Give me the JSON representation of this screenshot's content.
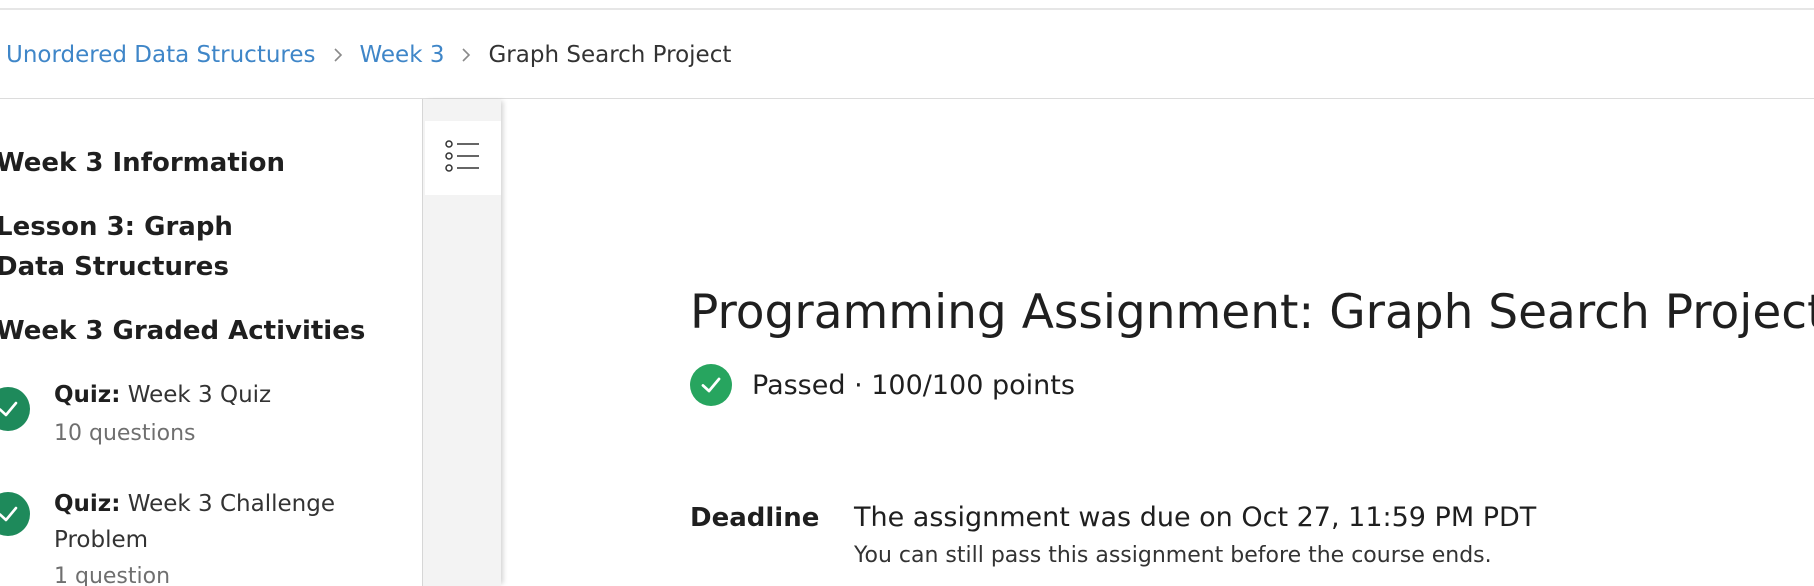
{
  "breadcrumb": {
    "items": [
      {
        "label": "Unordered Data Structures"
      },
      {
        "label": "Week 3"
      }
    ],
    "current": "Graph Search Project"
  },
  "sidebar": {
    "sections": [
      {
        "label": "Week 3 Information"
      },
      {
        "label": "Lesson 3: Graph Data Structures"
      },
      {
        "label": "Week 3 Graded Activities"
      }
    ],
    "items": [
      {
        "type": "Quiz:",
        "title": "Week 3 Quiz",
        "meta": "10 questions",
        "icon": "check-circle-icon"
      },
      {
        "type": "Quiz:",
        "title": "Week 3 Challenge Problem",
        "meta": "1 question",
        "icon": "check-circle-icon"
      }
    ]
  },
  "toggle": {
    "icon": "list-icon"
  },
  "main": {
    "title": "Programming Assignment: Graph Search Project",
    "status": {
      "text": "Passed · 100/100 points",
      "icon": "check-circle-icon"
    },
    "deadline": {
      "label": "Deadline",
      "text": "The assignment was due on Oct 27, 11:59 PM PDT",
      "note": "You can still pass this assignment before the course ends."
    }
  },
  "colors": {
    "link": "#3f86c8",
    "sidebar_check": "#1e8a5b",
    "status_check": "#27a55f",
    "text": "#1f1f1f"
  }
}
